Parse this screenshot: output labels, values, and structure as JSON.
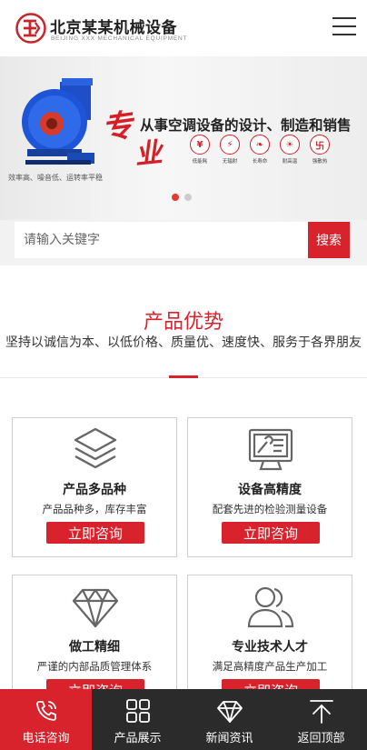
{
  "header": {
    "brand_name": "北京某某机械设备",
    "brand_sub": "BEIJING XXX MECHANICAL EQUIPMENT",
    "logo_icon": "logo-emblem-icon",
    "menu_icon": "hamburger-menu-icon"
  },
  "banner": {
    "calligraphy_1": "专",
    "calligraphy_2": "业",
    "title": "从事空调设备的设计、制造和销售",
    "caption": "效率高、噪音低、运转率平稳",
    "features": [
      {
        "symbol": "¥",
        "label": "低能耗"
      },
      {
        "symbol": "⚡",
        "label": "无辐射"
      },
      {
        "symbol": "❧",
        "label": "长寿命"
      },
      {
        "symbol": "☀",
        "label": "耐高温"
      },
      {
        "symbol": "卐",
        "label": "强散热"
      }
    ],
    "slides_total": 2,
    "slide_active": 1,
    "accent_color": "#d51f26"
  },
  "search": {
    "placeholder": "请输入关键字",
    "button_label": "搜索"
  },
  "section": {
    "title": "产品优势",
    "description": "坚持以诚信为本、以低价格、质量优、速度快、服务于各界朋友"
  },
  "cards": [
    {
      "icon": "layers-icon",
      "title": "产品多品种",
      "desc": "产品品种多，库存丰富",
      "button": "立即咨询"
    },
    {
      "icon": "monitor-tools-icon",
      "title": "设备高精度",
      "desc": "配套先进的检验测量设备",
      "button": "立即咨询"
    },
    {
      "icon": "diamond-icon",
      "title": "做工精细",
      "desc": "严谨的内部品质管理体系",
      "button": "立即咨询"
    },
    {
      "icon": "users-icon",
      "title": "专业技术人才",
      "desc": "满足高精度产品生产加工",
      "button": "立即咨询"
    }
  ],
  "footer": {
    "items": [
      {
        "icon": "phone-icon",
        "label": "电话咨询"
      },
      {
        "icon": "grid-icon",
        "label": "产品展示"
      },
      {
        "icon": "diamond-icon",
        "label": "新闻资讯"
      },
      {
        "icon": "back-to-top-icon",
        "label": "返回顶部"
      }
    ],
    "active_index": 0
  },
  "colors": {
    "brand_red": "#d8222c",
    "footer_bg": "#2b2b2b"
  }
}
